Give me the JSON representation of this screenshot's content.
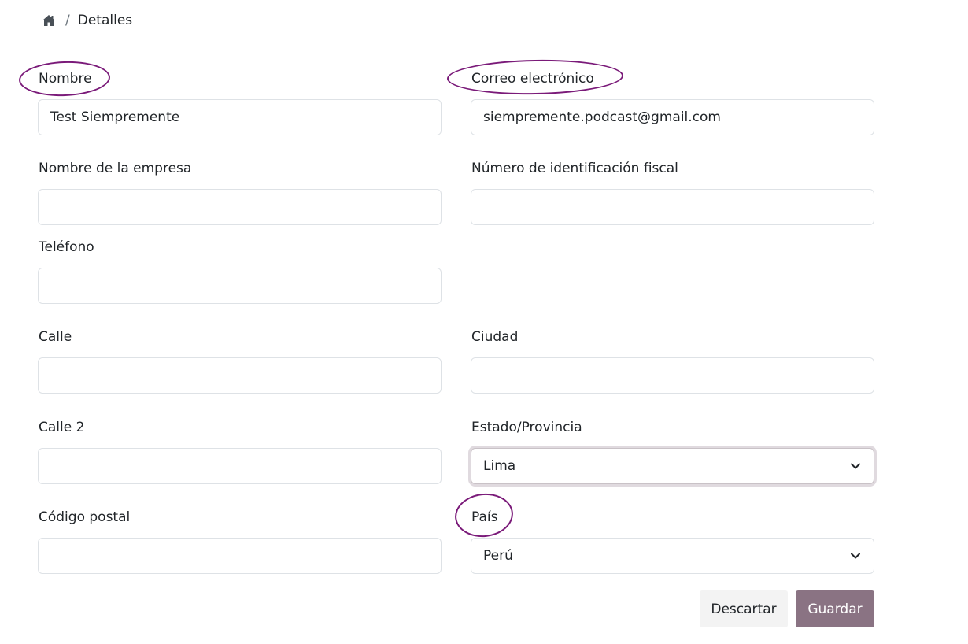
{
  "breadcrumb": {
    "home_icon": "home-icon",
    "separator": "/",
    "current": "Detalles"
  },
  "form": {
    "name": {
      "label": "Nombre",
      "value": "Test Siempremente"
    },
    "email": {
      "label": "Correo electrónico",
      "value": "siempremente.podcast@gmail.com"
    },
    "company": {
      "label": "Nombre de la empresa",
      "value": ""
    },
    "tax_id": {
      "label": "Número de identificación fiscal",
      "value": ""
    },
    "phone": {
      "label": "Teléfono",
      "value": ""
    },
    "street": {
      "label": "Calle",
      "value": ""
    },
    "city": {
      "label": "Ciudad",
      "value": ""
    },
    "street2": {
      "label": "Calle 2",
      "value": ""
    },
    "state": {
      "label": "Estado/Provincia",
      "value": "Lima"
    },
    "zip": {
      "label": "Código postal",
      "value": ""
    },
    "country": {
      "label": "País",
      "value": "Perú"
    }
  },
  "actions": {
    "discard": "Descartar",
    "save": "Guardar"
  },
  "colors": {
    "annotation_circle": "#7a1a79",
    "save_button": "#8a7383",
    "discard_button": "#f3f3f3"
  }
}
